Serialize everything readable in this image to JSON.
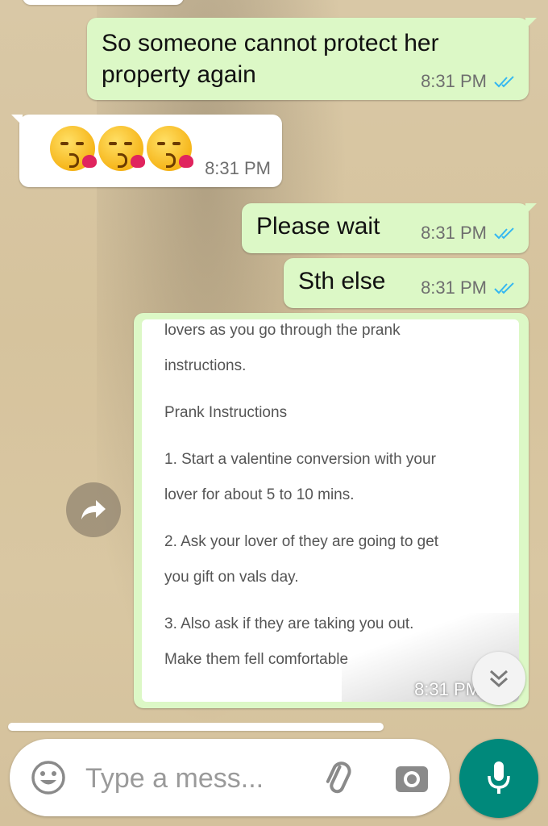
{
  "messages": [
    {
      "text": "So someone cannot protect her property again",
      "time": "8:31 PM"
    },
    {
      "emoji": "face-blowing-a-kiss x3",
      "time": "8:31 PM"
    },
    {
      "text": "Please wait",
      "time": "8:31 PM"
    },
    {
      "text": "Sth else",
      "time": "8:31 PM"
    }
  ],
  "document": {
    "lines": [
      "lovers as you go through the prank",
      "instructions.",
      "Prank Instructions",
      "1. Start a valentine conversion with your",
      "lover for about 5 to 10 mins.",
      "2. Ask your lover of they are going to get",
      "you gift on vals day.",
      "3. Also ask if they are taking you out.",
      "Make them fell comfortable"
    ],
    "time": "8:31 PM"
  },
  "composer": {
    "placeholder": "Type a mess..."
  },
  "icons": {
    "read_ticks": "double-check-icon",
    "emoji": "emoji-icon",
    "attach": "paperclip-icon",
    "camera": "camera-icon",
    "mic": "mic-icon",
    "forward": "forward-icon",
    "scroll": "chevron-double-down-icon"
  },
  "colors": {
    "outgoing_bubble": "#dcf8c6",
    "incoming_bubble": "#ffffff",
    "tick_blue": "#34b7f1",
    "mic_green": "#00897b"
  }
}
